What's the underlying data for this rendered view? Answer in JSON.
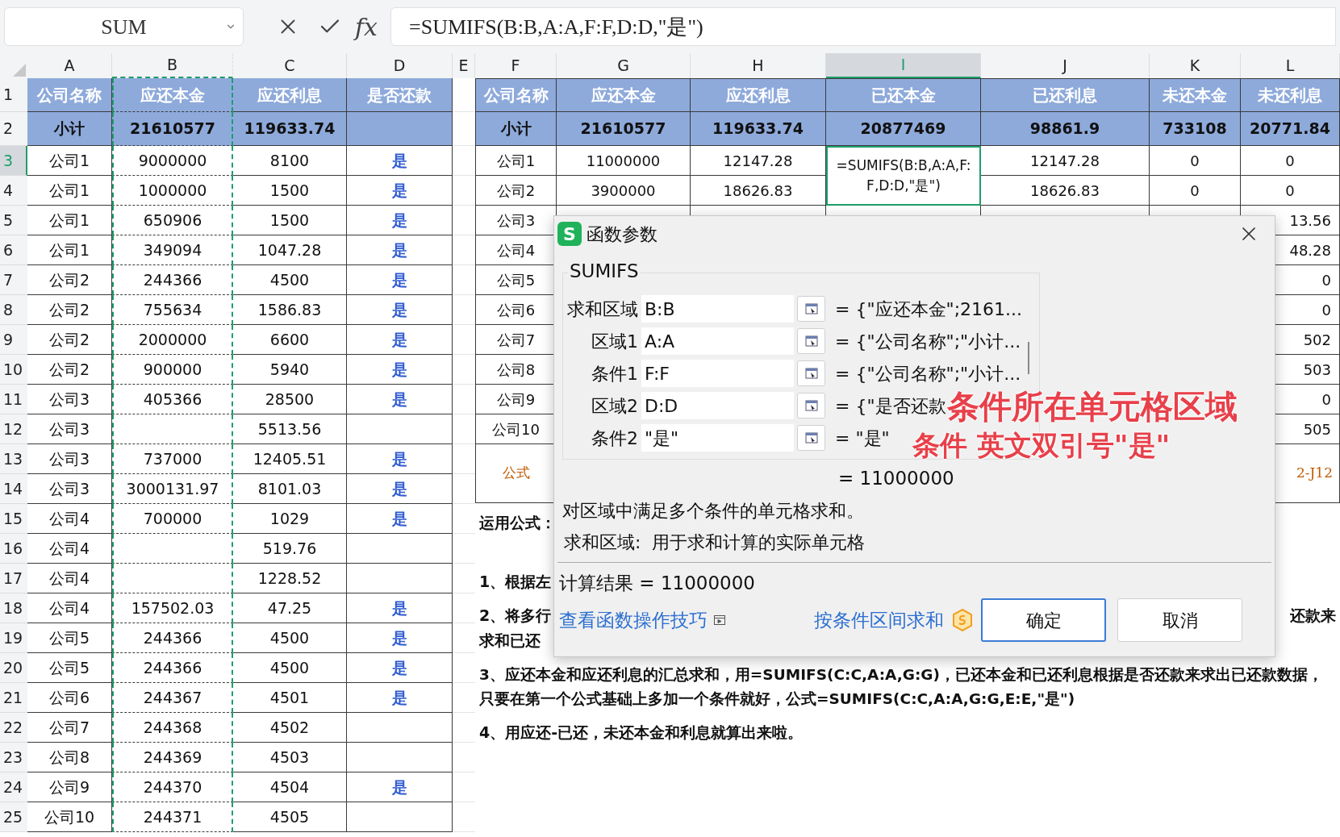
{
  "formula_bar": {
    "name_box": "SUM",
    "function_label": "fx",
    "formula": "=SUMIFS(B:B,A:A,F:F,D:D,\"是\")"
  },
  "column_headers": [
    {
      "label": "A",
      "selected": false,
      "marquee": false
    },
    {
      "label": "B",
      "selected": false,
      "marquee": true
    },
    {
      "label": "C",
      "selected": false,
      "marquee": false
    },
    {
      "label": "D",
      "selected": false,
      "marquee": false
    },
    {
      "label": "E",
      "selected": false,
      "marquee": false
    },
    {
      "label": "F",
      "selected": false,
      "marquee": false
    },
    {
      "label": "G",
      "selected": false,
      "marquee": false
    },
    {
      "label": "H",
      "selected": false,
      "marquee": false
    },
    {
      "label": "I",
      "selected": true,
      "marquee": false
    },
    {
      "label": "J",
      "selected": false,
      "marquee": false
    },
    {
      "label": "K",
      "selected": false,
      "marquee": false
    },
    {
      "label": "L",
      "selected": false,
      "marquee": false
    }
  ],
  "row_numbers": [
    {
      "label": "1",
      "selected": false
    },
    {
      "label": "2",
      "selected": false
    },
    {
      "label": "3",
      "selected": true
    },
    {
      "label": "4",
      "selected": false
    },
    {
      "label": "5",
      "selected": false
    },
    {
      "label": "6",
      "selected": false
    },
    {
      "label": "7",
      "selected": false
    },
    {
      "label": "8",
      "selected": false
    },
    {
      "label": "9",
      "selected": false
    },
    {
      "label": "10",
      "selected": false
    },
    {
      "label": "11",
      "selected": false
    },
    {
      "label": "12",
      "selected": false
    },
    {
      "label": "13",
      "selected": false
    },
    {
      "label": "14",
      "selected": false
    },
    {
      "label": "15",
      "selected": false
    },
    {
      "label": "16",
      "selected": false
    },
    {
      "label": "17",
      "selected": false
    },
    {
      "label": "18",
      "selected": false
    },
    {
      "label": "19",
      "selected": false
    },
    {
      "label": "20",
      "selected": false
    },
    {
      "label": "21",
      "selected": false
    },
    {
      "label": "22",
      "selected": false
    },
    {
      "label": "23",
      "selected": false
    },
    {
      "label": "24",
      "selected": false
    },
    {
      "label": "25",
      "selected": false
    }
  ],
  "left_table": {
    "header": [
      "公司名称",
      "应还本金",
      "应还利息",
      "是否还款"
    ],
    "subtotal": [
      "小计",
      "21610577",
      "119633.74"
    ],
    "rows": [
      {
        "company": "公司1",
        "principal": "9000000",
        "interest": "8100",
        "repaid": "是"
      },
      {
        "company": "公司1",
        "principal": "1000000",
        "interest": "1500",
        "repaid": "是"
      },
      {
        "company": "公司1",
        "principal": "650906",
        "interest": "1500",
        "repaid": "是"
      },
      {
        "company": "公司1",
        "principal": "349094",
        "interest": "1047.28",
        "repaid": "是"
      },
      {
        "company": "公司2",
        "principal": "244366",
        "interest": "4500",
        "repaid": "是"
      },
      {
        "company": "公司2",
        "principal": "755634",
        "interest": "1586.83",
        "repaid": "是"
      },
      {
        "company": "公司2",
        "principal": "2000000",
        "interest": "6600",
        "repaid": "是"
      },
      {
        "company": "公司2",
        "principal": "900000",
        "interest": "5940",
        "repaid": "是"
      },
      {
        "company": "公司3",
        "principal": "405366",
        "interest": "28500",
        "repaid": "是"
      },
      {
        "company": "公司3",
        "interest": "5513.56"
      },
      {
        "company": "公司3",
        "principal": "737000",
        "interest": "12405.51",
        "repaid": "是"
      },
      {
        "company": "公司3",
        "principal": "3000131.97",
        "interest": "8101.03",
        "repaid": "是"
      },
      {
        "company": "公司4",
        "principal": "700000",
        "interest": "1029",
        "repaid": "是"
      },
      {
        "company": "公司4",
        "interest": "519.76"
      },
      {
        "company": "公司4",
        "interest": "1228.52"
      },
      {
        "company": "公司4",
        "principal": "157502.03",
        "interest": "47.25",
        "repaid": "是"
      },
      {
        "company": "公司5",
        "principal": "244366",
        "interest": "4500",
        "repaid": "是"
      },
      {
        "company": "公司5",
        "principal": "244366",
        "interest": "4500",
        "repaid": "是"
      },
      {
        "company": "公司6",
        "principal": "244367",
        "interest": "4501",
        "repaid": "是"
      },
      {
        "company": "公司7",
        "principal": "244368",
        "interest": "4502"
      },
      {
        "company": "公司8",
        "principal": "244369",
        "interest": "4503"
      },
      {
        "company": "公司9",
        "principal": "244370",
        "interest": "4504",
        "repaid": "是"
      },
      {
        "company": "公司10",
        "principal": "244371",
        "interest": "4505"
      }
    ]
  },
  "right_table": {
    "header": [
      "公司名称",
      "应还本金",
      "应还利息",
      "已还本金",
      "已还利息",
      "未还本金",
      "未还利息"
    ],
    "subtotal": [
      "小计",
      "21610577",
      "119633.74",
      "20877469",
      "98861.9",
      "733108",
      "20771.84"
    ],
    "editing_cell": "=SUMIFS(B:B,A:A,F:F,D:D,\"是\")",
    "rows": [
      {
        "f": "公司1",
        "g": "11000000",
        "h": "12147.28",
        "j": "12147.28",
        "k": "0",
        "l": "0"
      },
      {
        "f": "公司2",
        "g": "3900000",
        "h": "18626.83",
        "j": "18626.83",
        "k": "0",
        "l": "0"
      },
      {
        "f": "公司3",
        "l": "13.56"
      },
      {
        "f": "公司4",
        "l": "48.28"
      },
      {
        "f": "公司5",
        "l": "0"
      },
      {
        "f": "公司6",
        "l": "0"
      },
      {
        "f": "公司7",
        "l": "502"
      },
      {
        "f": "公司8",
        "l": "503"
      },
      {
        "f": "公司9",
        "l": "0"
      },
      {
        "f": "公司10",
        "l": "505"
      }
    ],
    "formula_row": {
      "f": "公式",
      "l": "2-J12"
    }
  },
  "notes": {
    "title": "运用公式：",
    "step_1": "1、根据左",
    "step_2_left": "2、将多行",
    "step_2_right": "还款来",
    "step_2_line_2": "求和已还",
    "step_3": "3、应还本金和应还利息的汇总求和，用=SUMIFS(C:C,A:A,G:G)，已还本金和已还利息根据是否还款来求出已还款数据，只要在第一个公式基础上多加一个条件就好，公式=SUMIFS(C:C,A:A,G:G,E:E,\"是\")",
    "step_4": "4、用应还-已还，未还本金和利息就算出来啦。"
  },
  "dialog": {
    "logo_letter": "S",
    "title": "函数参数",
    "function_name": "SUMIFS",
    "params": [
      {
        "label": "求和区域",
        "value": "B:B",
        "result": "= {\"应还本金\";2161..."
      },
      {
        "label": "区域1",
        "value": "A:A",
        "result": "= {\"公司名称\";\"小计..."
      },
      {
        "label": "条件1",
        "value": "F:F",
        "result": "= {\"公司名称\";\"小计..."
      },
      {
        "label": "区域2",
        "value": "D:D",
        "result": "= {\"是否还款"
      },
      {
        "label": "条件2",
        "value": "\"是\"",
        "result": "= \"是\""
      }
    ],
    "result": "= 11000000",
    "description": "对区域中满足多个条件的单元格求和。",
    "param_help": "求和区域:  用于求和计算的实际单元格",
    "calc_result": "计算结果 = 11000000",
    "tips_link": "查看函数操作技巧",
    "range_link": "按条件区间求和",
    "buttons": [
      {
        "label": "确定",
        "selected": true
      },
      {
        "label": "取消",
        "selected": false
      }
    ]
  },
  "annotations": [
    "条件所在单元格区域",
    "条件 英文双引号\"是\""
  ]
}
